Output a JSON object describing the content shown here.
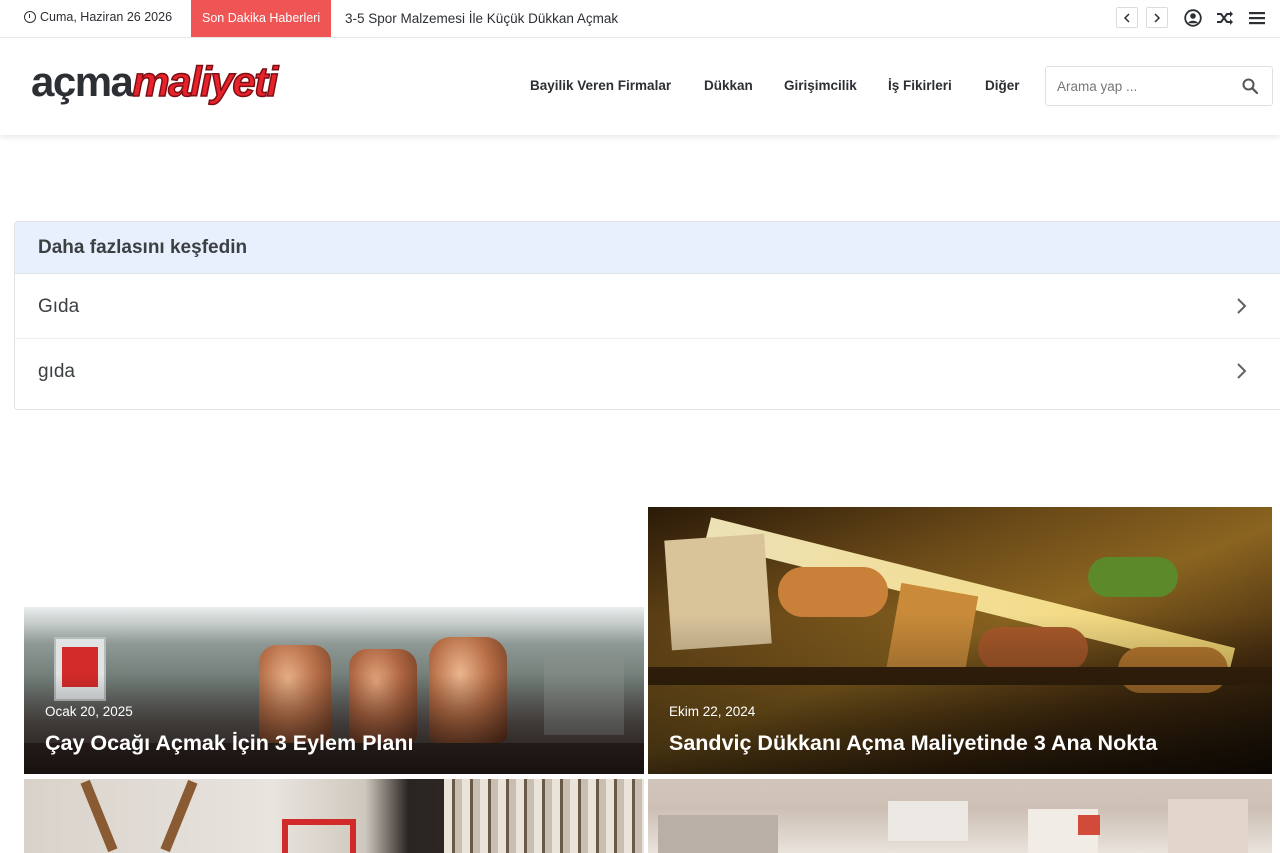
{
  "topbar": {
    "date": "Cuma, Haziran 26 2026",
    "breaking_label": "Son Dakika Haberleri",
    "ticker": "3-5 Spor Malzemesi İle Küçük Dükkan Açmak"
  },
  "header": {
    "logo_part1": "açma",
    "logo_part2": "maliyeti",
    "nav": [
      {
        "label": "Bayilik Veren Firmalar"
      },
      {
        "label": "Dükkan"
      },
      {
        "label": "Girişimcilik"
      },
      {
        "label": "İş Fikirleri"
      },
      {
        "label": "Diğer"
      }
    ],
    "search": {
      "placeholder": "Arama yap ..."
    }
  },
  "explore": {
    "title": "Daha fazlasını keşfedin",
    "items": [
      {
        "label": "Gıda"
      },
      {
        "label": "gıda"
      }
    ]
  },
  "posts": [
    {
      "date": "Ocak 20, 2025",
      "title": "Çay Ocağı Açmak İçin 3 Eylem Planı"
    },
    {
      "date": "Ekim 22, 2024",
      "title": "Sandviç Dükkanı Açma Maliyetinde 3 Ana Nokta"
    }
  ],
  "colors": {
    "accent": "#f05555",
    "logo_red": "#e8222b",
    "explore_bg": "#e8f0fe"
  }
}
